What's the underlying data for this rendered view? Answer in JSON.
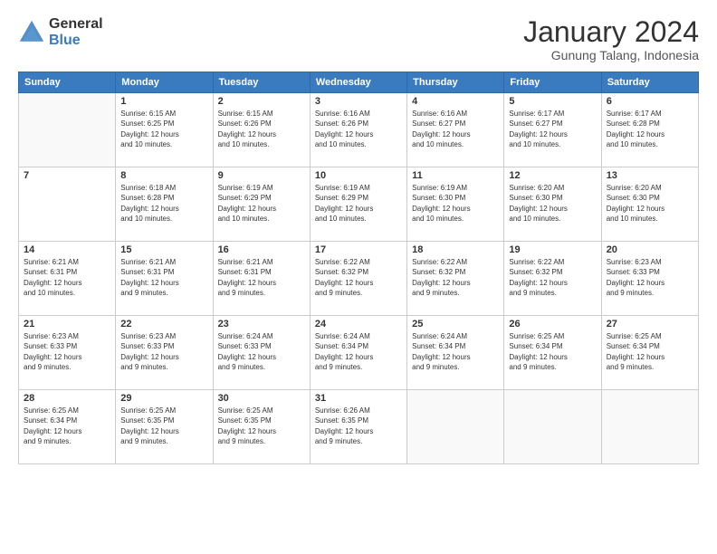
{
  "header": {
    "logo_general": "General",
    "logo_blue": "Blue",
    "month_title": "January 2024",
    "location": "Gunung Talang, Indonesia"
  },
  "days_of_week": [
    "Sunday",
    "Monday",
    "Tuesday",
    "Wednesday",
    "Thursday",
    "Friday",
    "Saturday"
  ],
  "weeks": [
    [
      {
        "day": "",
        "info": ""
      },
      {
        "day": "1",
        "info": "Sunrise: 6:15 AM\nSunset: 6:25 PM\nDaylight: 12 hours\nand 10 minutes."
      },
      {
        "day": "2",
        "info": "Sunrise: 6:15 AM\nSunset: 6:26 PM\nDaylight: 12 hours\nand 10 minutes."
      },
      {
        "day": "3",
        "info": "Sunrise: 6:16 AM\nSunset: 6:26 PM\nDaylight: 12 hours\nand 10 minutes."
      },
      {
        "day": "4",
        "info": "Sunrise: 6:16 AM\nSunset: 6:27 PM\nDaylight: 12 hours\nand 10 minutes."
      },
      {
        "day": "5",
        "info": "Sunrise: 6:17 AM\nSunset: 6:27 PM\nDaylight: 12 hours\nand 10 minutes."
      },
      {
        "day": "6",
        "info": "Sunrise: 6:17 AM\nSunset: 6:28 PM\nDaylight: 12 hours\nand 10 minutes."
      }
    ],
    [
      {
        "day": "7",
        "info": ""
      },
      {
        "day": "8",
        "info": "Sunrise: 6:18 AM\nSunset: 6:28 PM\nDaylight: 12 hours\nand 10 minutes."
      },
      {
        "day": "9",
        "info": "Sunrise: 6:19 AM\nSunset: 6:29 PM\nDaylight: 12 hours\nand 10 minutes."
      },
      {
        "day": "10",
        "info": "Sunrise: 6:19 AM\nSunset: 6:29 PM\nDaylight: 12 hours\nand 10 minutes."
      },
      {
        "day": "11",
        "info": "Sunrise: 6:19 AM\nSunset: 6:30 PM\nDaylight: 12 hours\nand 10 minutes."
      },
      {
        "day": "12",
        "info": "Sunrise: 6:20 AM\nSunset: 6:30 PM\nDaylight: 12 hours\nand 10 minutes."
      },
      {
        "day": "13",
        "info": "Sunrise: 6:20 AM\nSunset: 6:30 PM\nDaylight: 12 hours\nand 10 minutes."
      }
    ],
    [
      {
        "day": "14",
        "info": "Sunrise: 6:21 AM\nSunset: 6:31 PM\nDaylight: 12 hours\nand 10 minutes."
      },
      {
        "day": "15",
        "info": "Sunrise: 6:21 AM\nSunset: 6:31 PM\nDaylight: 12 hours\nand 9 minutes."
      },
      {
        "day": "16",
        "info": "Sunrise: 6:21 AM\nSunset: 6:31 PM\nDaylight: 12 hours\nand 9 minutes."
      },
      {
        "day": "17",
        "info": "Sunrise: 6:22 AM\nSunset: 6:32 PM\nDaylight: 12 hours\nand 9 minutes."
      },
      {
        "day": "18",
        "info": "Sunrise: 6:22 AM\nSunset: 6:32 PM\nDaylight: 12 hours\nand 9 minutes."
      },
      {
        "day": "19",
        "info": "Sunrise: 6:22 AM\nSunset: 6:32 PM\nDaylight: 12 hours\nand 9 minutes."
      },
      {
        "day": "20",
        "info": "Sunrise: 6:23 AM\nSunset: 6:33 PM\nDaylight: 12 hours\nand 9 minutes."
      }
    ],
    [
      {
        "day": "21",
        "info": "Sunrise: 6:23 AM\nSunset: 6:33 PM\nDaylight: 12 hours\nand 9 minutes."
      },
      {
        "day": "22",
        "info": "Sunrise: 6:23 AM\nSunset: 6:33 PM\nDaylight: 12 hours\nand 9 minutes."
      },
      {
        "day": "23",
        "info": "Sunrise: 6:24 AM\nSunset: 6:33 PM\nDaylight: 12 hours\nand 9 minutes."
      },
      {
        "day": "24",
        "info": "Sunrise: 6:24 AM\nSunset: 6:34 PM\nDaylight: 12 hours\nand 9 minutes."
      },
      {
        "day": "25",
        "info": "Sunrise: 6:24 AM\nSunset: 6:34 PM\nDaylight: 12 hours\nand 9 minutes."
      },
      {
        "day": "26",
        "info": "Sunrise: 6:25 AM\nSunset: 6:34 PM\nDaylight: 12 hours\nand 9 minutes."
      },
      {
        "day": "27",
        "info": "Sunrise: 6:25 AM\nSunset: 6:34 PM\nDaylight: 12 hours\nand 9 minutes."
      }
    ],
    [
      {
        "day": "28",
        "info": "Sunrise: 6:25 AM\nSunset: 6:34 PM\nDaylight: 12 hours\nand 9 minutes."
      },
      {
        "day": "29",
        "info": "Sunrise: 6:25 AM\nSunset: 6:35 PM\nDaylight: 12 hours\nand 9 minutes."
      },
      {
        "day": "30",
        "info": "Sunrise: 6:25 AM\nSunset: 6:35 PM\nDaylight: 12 hours\nand 9 minutes."
      },
      {
        "day": "31",
        "info": "Sunrise: 6:26 AM\nSunset: 6:35 PM\nDaylight: 12 hours\nand 9 minutes."
      },
      {
        "day": "",
        "info": ""
      },
      {
        "day": "",
        "info": ""
      },
      {
        "day": "",
        "info": ""
      }
    ]
  ]
}
